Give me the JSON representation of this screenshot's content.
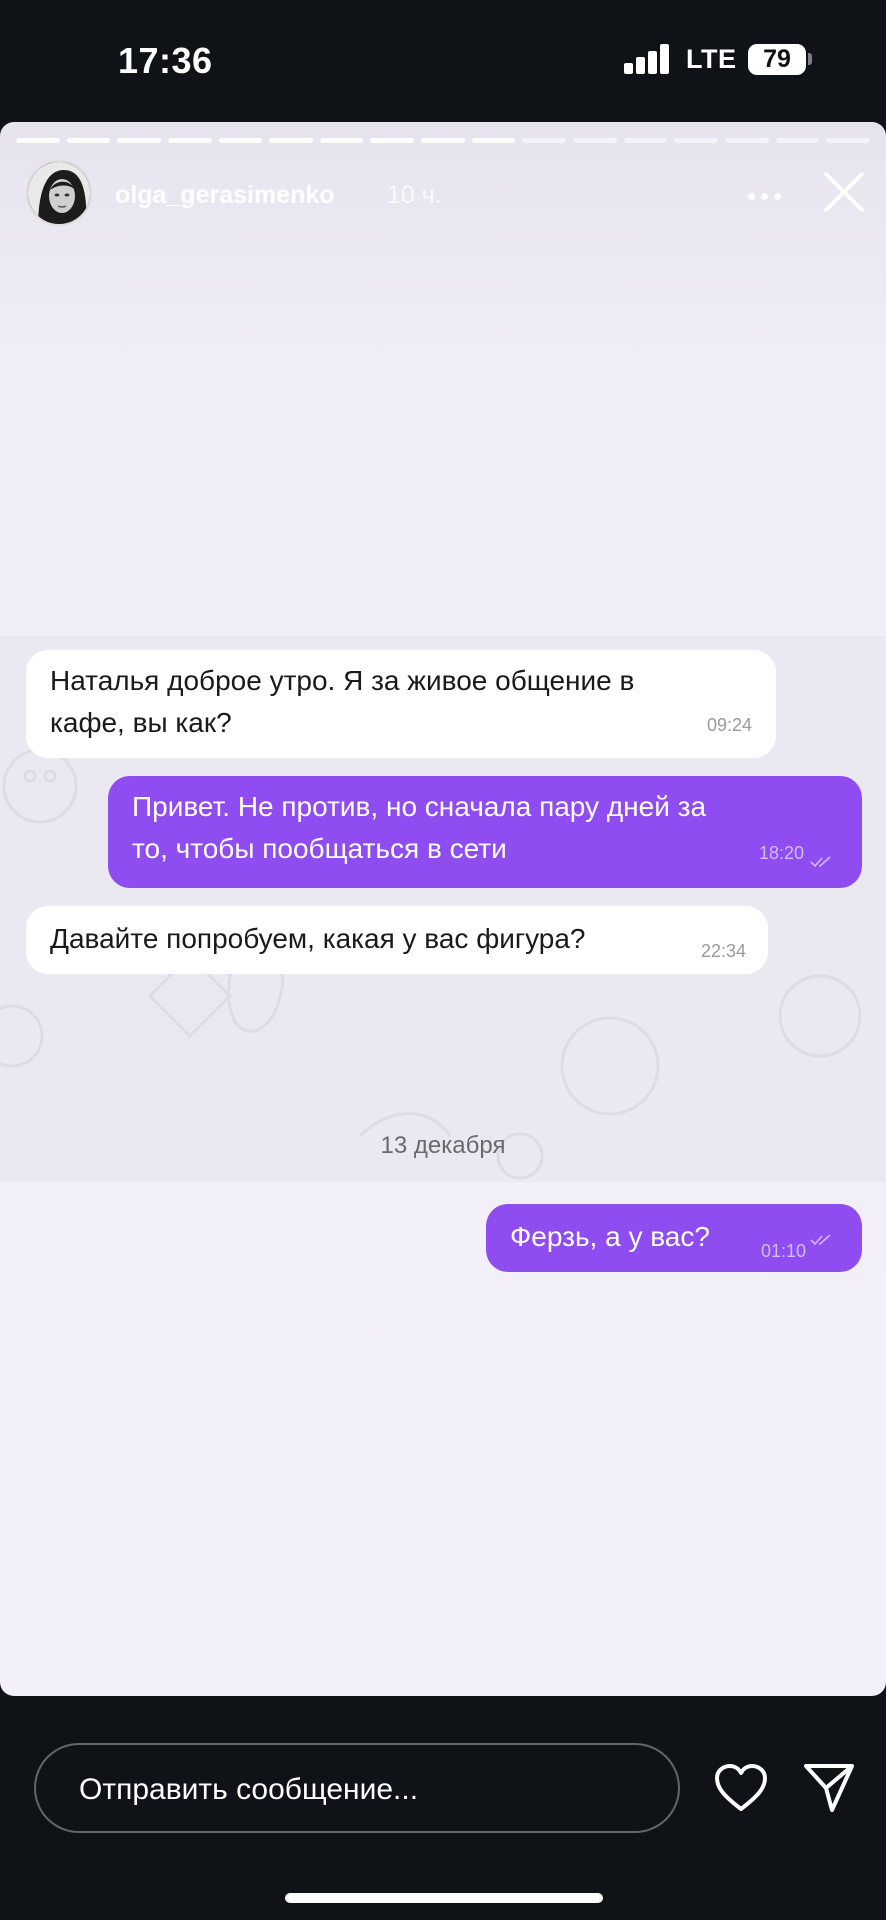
{
  "status_bar": {
    "time": "17:36",
    "network": "LTE",
    "battery": "79"
  },
  "story": {
    "progress": {
      "segments": 17,
      "completed": 10
    },
    "username": "olga_gerasimenko",
    "time_ago": "10 ч.",
    "icons": {
      "more": "more-dots-icon",
      "close": "close-icon"
    }
  },
  "chat": {
    "messages": [
      {
        "direction": "incoming",
        "text_line1": "Наталья доброе утро. Я за живое общение в",
        "text_line2": "кафе, вы как?",
        "time": "09:24"
      },
      {
        "direction": "outgoing",
        "text_line1": "Привет. Не против, но сначала пару дней за",
        "text_line2": "то, чтобы пообщаться в сети",
        "time": "18:20"
      },
      {
        "direction": "incoming",
        "text_line1": "Давайте попробуем, какая у вас фигура?",
        "time": "22:34"
      },
      {
        "direction": "outgoing",
        "text_line1": "Ферзь, а у вас?",
        "time": "01:10"
      }
    ],
    "date_separator": "13 декабря",
    "colors": {
      "outgoing_bubble": "#8f4cf0",
      "incoming_bubble": "#ffffff"
    }
  },
  "reply": {
    "placeholder": "Отправить сообщение...",
    "icons": {
      "like": "heart-icon",
      "send": "send-icon"
    }
  }
}
